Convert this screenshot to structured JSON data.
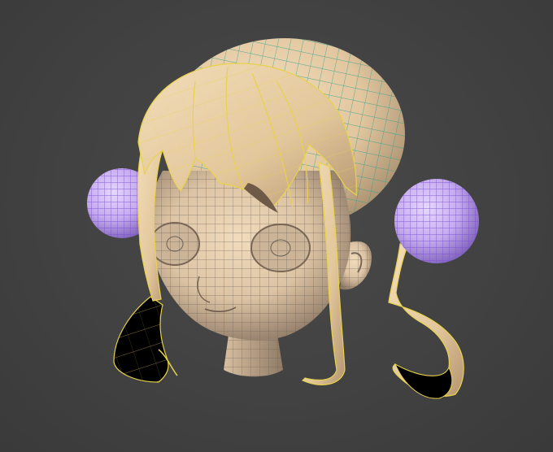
{
  "scene": {
    "subject": "head-model",
    "view": "perspective",
    "display_mode": "smooth-shaded-with-wireframe"
  },
  "colors": {
    "background": "#444444",
    "skin": "#e8cfae",
    "skin_shadow": "#7a6656",
    "wire_skin": "#6b6258",
    "hair": "#eed7b0",
    "hair_shadow": "#8a7458",
    "wire_hair_selected": "#e8d24a",
    "wire_cap": "#2fa08a",
    "buns": "#c3a8ec",
    "wire_buns": "#7b4fd6",
    "backface": "#000000"
  }
}
